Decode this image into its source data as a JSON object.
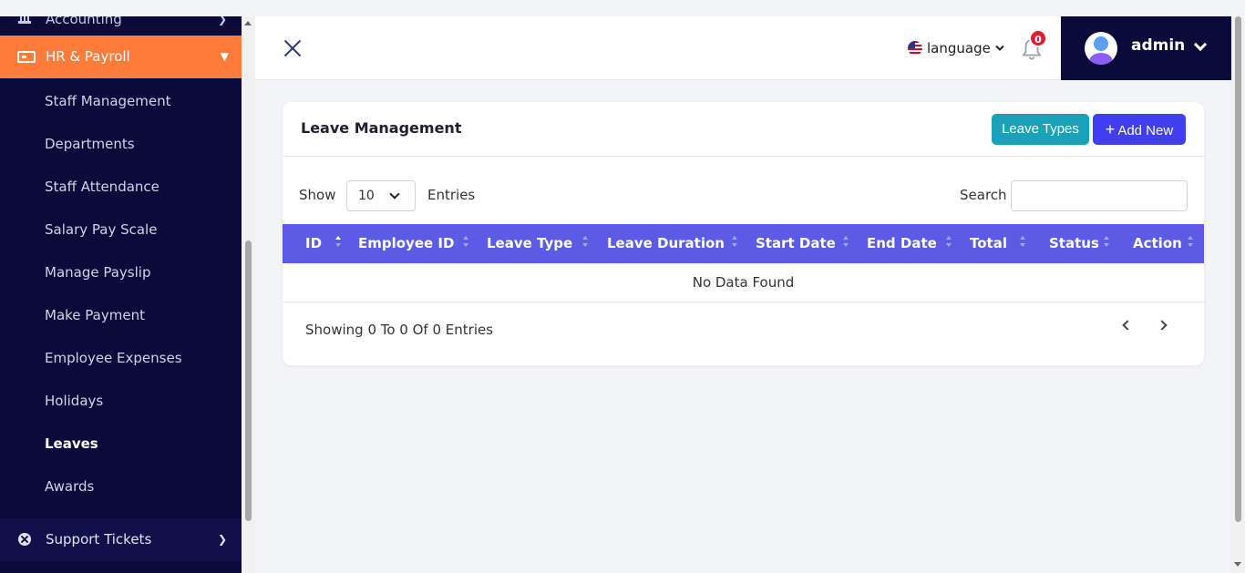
{
  "sidebar": {
    "top_item": "Accounting",
    "active_section": "HR & Payroll",
    "sub_items": [
      "Staff Management",
      "Departments",
      "Staff Attendance",
      "Salary Pay Scale",
      "Manage Payslip",
      "Make Payment",
      "Employee Expenses",
      "Holidays",
      "Leaves",
      "Awards"
    ],
    "current_item": "Leaves",
    "support": "Support Tickets"
  },
  "header": {
    "language": "language",
    "notification_count": "0",
    "username": "admin"
  },
  "card": {
    "title": "Leave Management",
    "leave_types_button": "Leave Types",
    "add_new_button": "Add New",
    "show_label": "Show",
    "page_size": "10",
    "entries_label": "Entries",
    "search_label": "Search",
    "search_value": ""
  },
  "table": {
    "columns": [
      "ID",
      "Employee ID",
      "Leave Type",
      "Leave Duration",
      "Start Date",
      "End Date",
      "Total",
      "Status",
      "Action"
    ],
    "empty_text": "No Data Found",
    "footer": "Showing 0 To 0 Of 0 Entries"
  },
  "colors": {
    "sidebar_bg": "#0b0b3b",
    "active_accent": "#fe7c3a",
    "table_header": "#5b5be6",
    "btn_types": "#17a2b8",
    "btn_add": "#3f3ff0",
    "badge": "#e11d2d"
  }
}
